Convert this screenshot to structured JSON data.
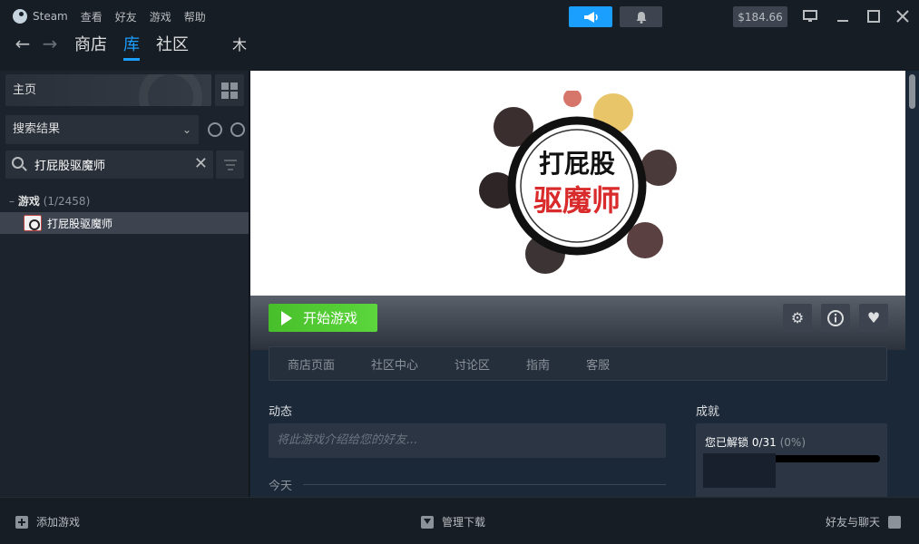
{
  "menu": {
    "logo_label": "Steam",
    "items": [
      "查看",
      "好友",
      "游戏",
      "帮助"
    ]
  },
  "nav": {
    "back_icon": "arrow-left-icon",
    "forward_icon": "arrow-right-icon",
    "tabs": [
      "商店",
      "库",
      "社区"
    ],
    "active_tab": "库",
    "user_label": "木"
  },
  "header_buttons": {
    "announce_icon": "megaphone-icon",
    "notification_icon": "bell-icon",
    "wallet": "$184.66",
    "accent_color": "#1a9fff"
  },
  "sidebar": {
    "home_label": "主页",
    "filter_label": "搜索结果",
    "search_value": "打屁股驱魔师",
    "games_header": {
      "label": "游戏",
      "count": "(1/2458)"
    },
    "game_item": "打屁股驱魔师"
  },
  "hero": {
    "logo_line1": "打屁股",
    "logo_line2": "驱魔师"
  },
  "actions": {
    "play_label": "开始游戏",
    "play_color": "#5cd63c"
  },
  "subnav": [
    "商店页面",
    "社区中心",
    "讨论区",
    "指南",
    "客服"
  ],
  "activity": {
    "title": "动态",
    "placeholder": "将此游戏介绍给您的好友...",
    "today": "今天"
  },
  "achievements": {
    "title": "成就",
    "unlocked": "您已解锁 0/31",
    "percent": "(0%)",
    "progress": 0
  },
  "bottom": {
    "add_game": "添加游戏",
    "manage_downloads": "管理下载",
    "friends_chat": "好友与聊天"
  }
}
